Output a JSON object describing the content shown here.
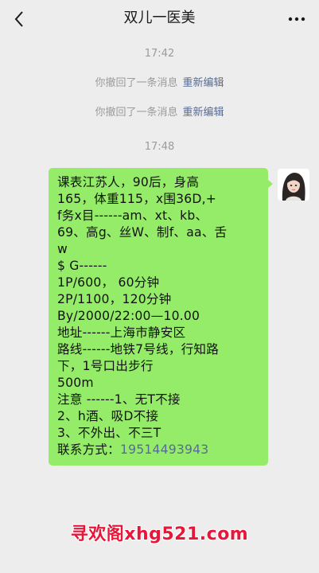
{
  "header": {
    "title": "双儿一医美",
    "back_icon": "chevron-left-icon",
    "more_icon": "more-dots-icon"
  },
  "messages": {
    "time1": "17:42",
    "recall_text": "你撤回了一条消息",
    "reedit_label": "重新编辑",
    "time2": "17:48",
    "bubble_lines": [
      "课表江苏人，90后，身高",
      "165，体重115，x围36D,+",
      "f务x目------am、xt、kb、",
      "69、高g、丝W、制f、aa、舌",
      "w",
      "$ G------",
      "1P/600， 60分钟",
      "2P/1100，120分钟",
      "By/2000/22:00—10.00",
      "地址------上海市静安区",
      "路线------地铁7号线，行知路",
      "下，1号口出步行",
      "500m",
      "注意 ------1、无T不接",
      "2、h酒、吸D不接",
      "3、不外出、不三T"
    ],
    "contact_label": "联系方式：",
    "contact_phone": "19514493943"
  },
  "watermark": "寻欢阁xhg521.com",
  "colors": {
    "background": "#ededed",
    "bubble": "#95ec69",
    "link": "#576b95",
    "watermark": "#e8173a"
  }
}
